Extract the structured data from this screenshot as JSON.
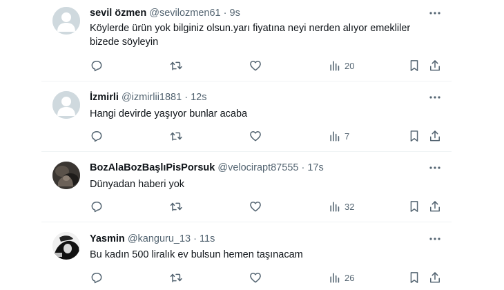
{
  "tweets": [
    {
      "name": "sevil özmen",
      "handle": "@sevilozmen61",
      "sep": "·",
      "time": "9s",
      "text": "Köylerde ürün yok bilginiz olsun.yarı fiyatına neyi nerden alıyor emekliler bizede söyleyin",
      "views": "20",
      "avatar": "default-avatar"
    },
    {
      "name": "İzmirli",
      "handle": "@izmirlii1881",
      "sep": "·",
      "time": "12s",
      "text": "Hangi devirde yaşıyor bunlar acaba",
      "views": "7",
      "avatar": "default-avatar"
    },
    {
      "name": "BozAlaBozBaşlıPisPorsuk",
      "handle": "@velocirapt87555",
      "sep": "·",
      "time": "17s",
      "text": "Dünyadan haberi yok",
      "views": "32",
      "avatar": "dark-photo-avatar"
    },
    {
      "name": "Yasmin",
      "handle": "@kanguru_13",
      "sep": "·",
      "time": "11s",
      "text": "Bu kadın 500 liralık ev bulsun hemen taşınacam",
      "views": "26",
      "avatar": "bw-photo-avatar"
    }
  ],
  "icons": {
    "reply": "reply-icon",
    "retweet": "retweet-icon",
    "like": "like-icon",
    "views": "views-icon",
    "bookmark": "bookmark-icon",
    "share": "share-icon",
    "more": "more-icon"
  },
  "colors": {
    "text": "#0f1419",
    "secondary": "#536471",
    "divider": "#eff3f4",
    "default_avatar": "#cfd9de"
  }
}
